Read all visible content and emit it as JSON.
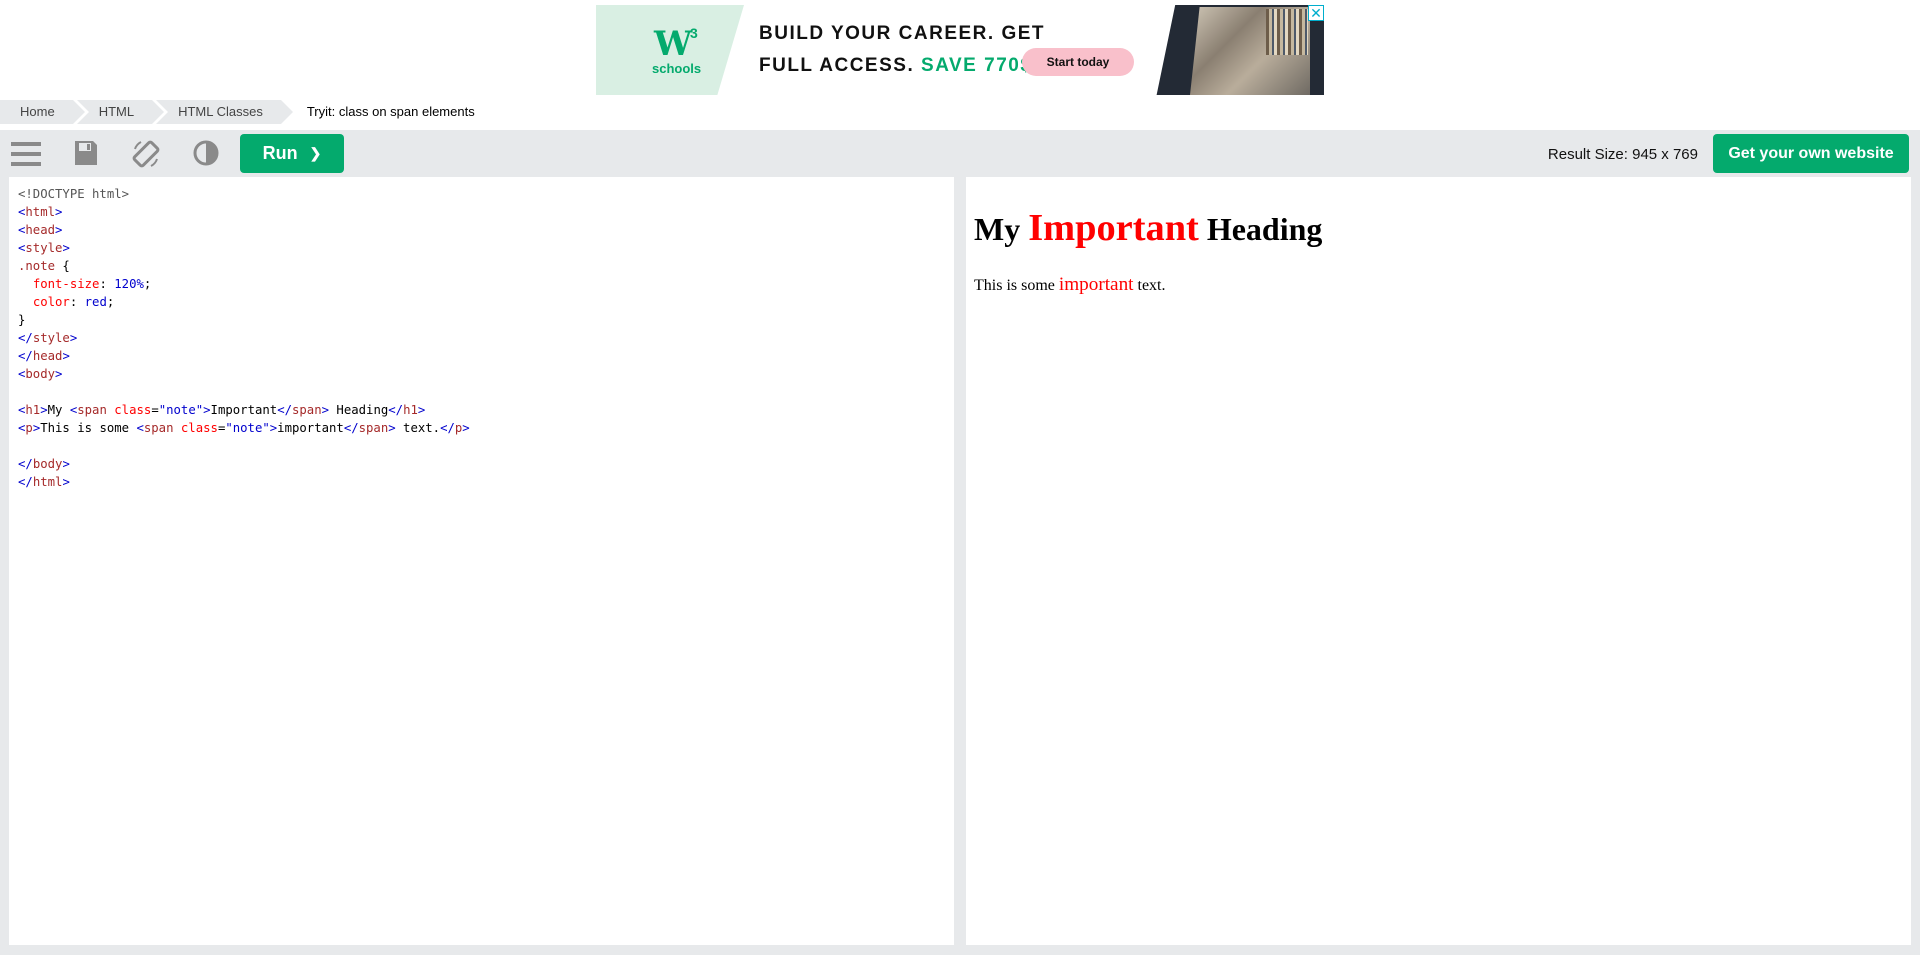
{
  "ad": {
    "logo_mark": "W",
    "logo_sup": "3",
    "logo_text": "schools",
    "headline_1": "BUILD YOUR CAREER. GET",
    "headline_2": "FULL ACCESS.",
    "headline_save": "SAVE 770$",
    "cta": "Start today",
    "close": "✕"
  },
  "breadcrumb": [
    "Home",
    "HTML",
    "HTML Classes",
    "Tryit: class on span elements"
  ],
  "toolbar": {
    "icons": [
      "menu-icon",
      "save-icon",
      "rotate-icon",
      "contrast-icon"
    ],
    "run_label": "Run",
    "run_chevron": "❯",
    "result_size": "Result Size: 945 x 769",
    "get_website": "Get your own website"
  },
  "colors": {
    "accent": "#04aa6d",
    "toolbar_bg": "#e7e9eb",
    "highlight": "#ff0000"
  },
  "code": {
    "doctype": "<!DOCTYPE html>",
    "selector": ".note",
    "font_size_prop": "font-size",
    "font_size_val": "120%",
    "color_prop": "color",
    "color_val": "red",
    "h1_before": "My ",
    "h1_span": "Important",
    "h1_after": " Heading",
    "p_before": "This is some ",
    "p_span": "important",
    "p_after": " text.",
    "class_attr": "class",
    "class_val": "\"note\""
  },
  "result": {
    "h1_before": "My ",
    "h1_span": "Important",
    "h1_after": " Heading",
    "p_before": "This is some ",
    "p_span": "important",
    "p_after": " text."
  }
}
